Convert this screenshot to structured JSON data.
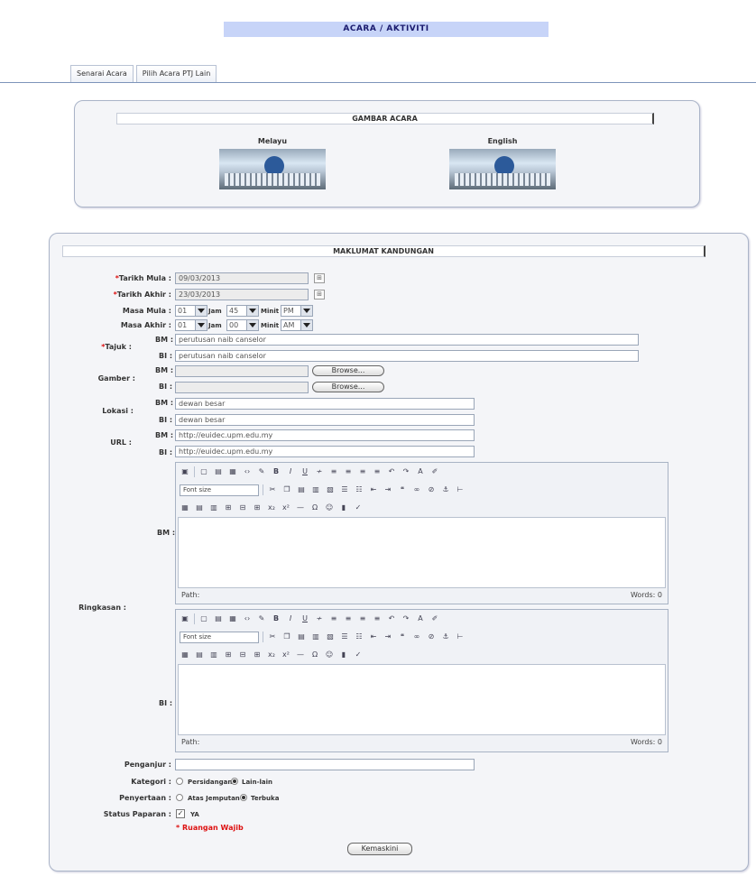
{
  "header": {
    "title": "ACARA / AKTIVITI"
  },
  "tabs": [
    {
      "label": "Senarai Acara"
    },
    {
      "label": "Pilih Acara PTJ Lain"
    }
  ],
  "gambar": {
    "heading": "GAMBAR ACARA",
    "melayu_label": "Melayu",
    "english_label": "English"
  },
  "maklumat": {
    "heading": "MAKLUMAT KANDUNGAN",
    "required_mark": "*",
    "tarikh_mula": {
      "label": "Tarikh Mula :",
      "value": "09/03/2013"
    },
    "tarikh_akhir": {
      "label": "Tarikh Akhir :",
      "value": "23/03/2013"
    },
    "calendar_glyph": "⊞",
    "masa_mula": {
      "label": "Masa Mula :",
      "jam": "01",
      "minit": "45",
      "ampm": "PM"
    },
    "masa_akhir": {
      "label": "Masa Akhir :",
      "jam": "01",
      "minit": "00",
      "ampm": "AM"
    },
    "jam_label": "Jam",
    "minit_label": "Minit",
    "bm_label": "BM :",
    "bi_label": "BI :",
    "tajuk": {
      "label": "Tajuk :",
      "bm": "perutusan naib canselor",
      "bi": "perutusan naib canselor"
    },
    "gambar": {
      "label": "Gamber :",
      "browse": "Browse..."
    },
    "lokasi": {
      "label": "Lokasi :",
      "bm": "dewan besar",
      "bi": "dewan besar"
    },
    "url": {
      "label": "URL :",
      "bm": "http://euidec.upm.edu.my",
      "bi": "http://euidec.upm.edu.my"
    },
    "ringkasan": {
      "label": "Ringkasan :"
    },
    "editor": {
      "font_size": "Font size",
      "path": "Path:",
      "words": "Words: 0"
    },
    "penganjur": {
      "label": "Penganjur :",
      "value": ""
    },
    "kategori": {
      "label": "Kategori :",
      "options": [
        "Persidangan",
        "Lain-lain"
      ],
      "selected": "Lain-lain"
    },
    "penyertaan": {
      "label": "Penyertaan :",
      "options": [
        "Atas Jemputan",
        "Terbuka"
      ],
      "selected": "Terbuka"
    },
    "status": {
      "label": "Status Paparan :",
      "checkbox_label": "YA",
      "check_glyph": "✓"
    },
    "wajib": "* Ruangan Wajib",
    "submit": "Kemaskini"
  }
}
